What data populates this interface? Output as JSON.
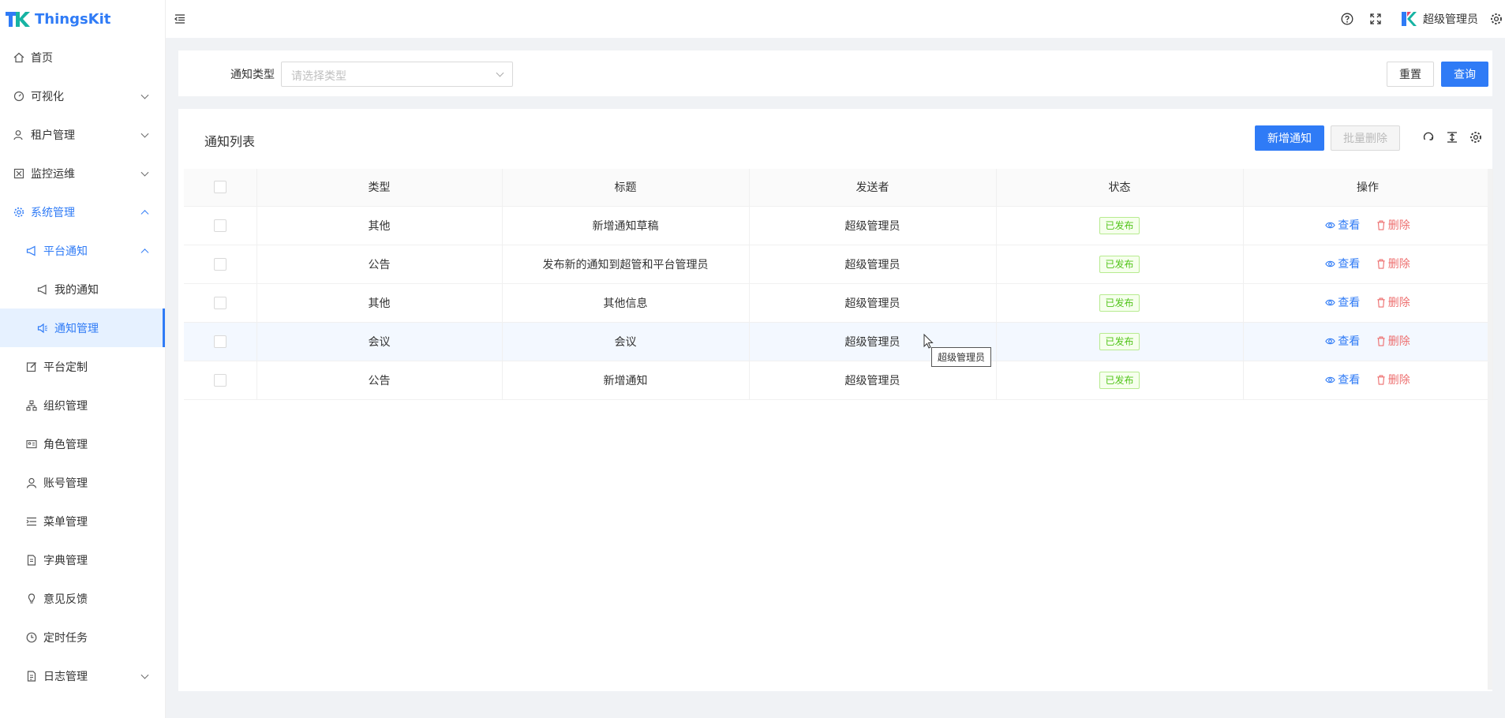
{
  "app": {
    "name": "ThingsKit"
  },
  "header": {
    "user_name": "超级管理员"
  },
  "sidebar": {
    "items": [
      {
        "label": "首页"
      },
      {
        "label": "可视化"
      },
      {
        "label": "租户管理"
      },
      {
        "label": "监控运维"
      },
      {
        "label": "系统管理"
      },
      {
        "label": "平台通知"
      },
      {
        "label": "我的通知"
      },
      {
        "label": "通知管理"
      },
      {
        "label": "平台定制"
      },
      {
        "label": "组织管理"
      },
      {
        "label": "角色管理"
      },
      {
        "label": "账号管理"
      },
      {
        "label": "菜单管理"
      },
      {
        "label": "字典管理"
      },
      {
        "label": "意见反馈"
      },
      {
        "label": "定时任务"
      },
      {
        "label": "日志管理"
      }
    ]
  },
  "search": {
    "label": "通知类型",
    "placeholder": "请选择类型",
    "reset_label": "重置",
    "query_label": "查询"
  },
  "table": {
    "title": "通知列表",
    "add_label": "新增通知",
    "batch_delete_label": "批量删除",
    "columns": [
      "类型",
      "标题",
      "发送者",
      "状态",
      "操作"
    ],
    "rows": [
      {
        "type": "其他",
        "title": "新增通知草稿",
        "sender": "超级管理员",
        "status": "已发布"
      },
      {
        "type": "公告",
        "title": "发布新的通知到超管和平台管理员",
        "sender": "超级管理员",
        "status": "已发布"
      },
      {
        "type": "其他",
        "title": "其他信息",
        "sender": "超级管理员",
        "status": "已发布"
      },
      {
        "type": "会议",
        "title": "会议",
        "sender": "超级管理员",
        "status": "已发布"
      },
      {
        "type": "公告",
        "title": "新增通知",
        "sender": "超级管理员",
        "status": "已发布"
      }
    ],
    "view_label": "查看",
    "delete_label": "删除"
  },
  "tooltip": {
    "text": "超级管理员"
  },
  "colors": {
    "primary": "#2f7bf6",
    "danger": "#ed6f6f",
    "success": "#52c41a"
  }
}
